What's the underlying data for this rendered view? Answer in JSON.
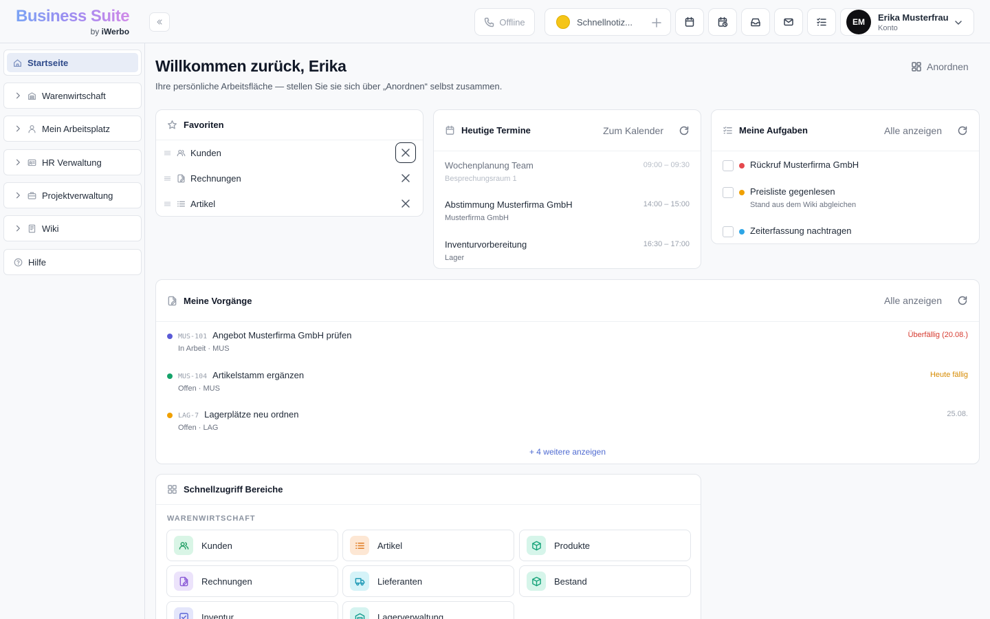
{
  "brand": {
    "title": "Business Suite",
    "by": "by",
    "company": "iWerbo"
  },
  "header": {
    "status": "Offline",
    "quick_note": "Schnellnotiz...",
    "user": {
      "initials": "EM",
      "name": "Erika Musterfrau",
      "role": "Konto"
    }
  },
  "sidebar": {
    "items": [
      {
        "label": "Startseite",
        "icon": "home-icon",
        "active": true
      },
      {
        "label": "Warenwirtschaft",
        "icon": "building-icon"
      },
      {
        "label": "Mein Arbeitsplatz",
        "icon": "user-icon"
      },
      {
        "label": "HR Verwaltung",
        "icon": "id-card-icon"
      },
      {
        "label": "Projektverwaltung",
        "icon": "briefcase-icon"
      },
      {
        "label": "Wiki",
        "icon": "book-icon"
      },
      {
        "label": "Hilfe",
        "icon": "help-icon"
      }
    ]
  },
  "main": {
    "title": "Willkommen zurück, Erika",
    "subtitle": "Ihre persönliche Arbeitsfläche — stellen Sie sie sich über „Anordnen“ selbst zusammen.",
    "arrange": "Anordnen"
  },
  "favorites": {
    "title": "Favoriten",
    "items": [
      {
        "label": "Kunden",
        "icon": "users-icon"
      },
      {
        "label": "Rechnungen",
        "icon": "invoice-icon"
      },
      {
        "label": "Artikel",
        "icon": "list-icon"
      }
    ]
  },
  "appointments": {
    "title": "Heutige Termine",
    "link": "Zum Kalender",
    "items": [
      {
        "title": "Wochenplanung Team",
        "place": "Besprechungsraum 1",
        "time": "09:00 – 09:30",
        "past": true
      },
      {
        "title": "Abstimmung Musterfirma GmbH",
        "place": "Musterfirma GmbH",
        "time": "14:00 – 15:00"
      },
      {
        "title": "Inventurvorbereitung",
        "place": "Lager",
        "time": "16:30 – 17:00"
      }
    ]
  },
  "tasks": {
    "title": "Meine Aufgaben",
    "link": "Alle anzeigen",
    "items": [
      {
        "title": "Rückruf Musterfirma GmbH",
        "sub": "",
        "color": "#e5484d"
      },
      {
        "title": "Preisliste gegenlesen",
        "sub": "Stand aus dem Wiki abgleichen",
        "color": "#f0a000"
      },
      {
        "title": "Zeiterfassung nachtragen",
        "sub": "",
        "color": "#2ea6e6"
      }
    ]
  },
  "processes": {
    "title": "Meine Vorgänge",
    "link": "Alle anzeigen",
    "more": "+ 4 weitere anzeigen",
    "items": [
      {
        "code": "MUS-101",
        "title": "Angebot Musterfirma GmbH prüfen",
        "meta": "In Arbeit · MUS",
        "due": "Überfällig (20.08.)",
        "dot": "#5b5bd6",
        "due_color": "#d63a2f"
      },
      {
        "code": "MUS-104",
        "title": "Artikelstamm ergänzen",
        "meta": "Offen · MUS",
        "due": "Heute fällig",
        "dot": "#16a36a",
        "due_color": "#d68a00"
      },
      {
        "code": "LAG-7",
        "title": "Lagerplätze neu ordnen",
        "meta": "Offen · LAG",
        "due": "25.08.",
        "dot": "#f0a000",
        "due_color": "#9aa1ad"
      }
    ]
  },
  "quick_access": {
    "title": "Schnellzugriff Bereiche",
    "section": "WARENWIRTSCHAFT",
    "tiles": [
      {
        "label": "Kunden",
        "icon": "users-icon",
        "bg": "#d9f5e6",
        "fg": "#1f9d63"
      },
      {
        "label": "Artikel",
        "icon": "list-icon",
        "bg": "#fde7d4",
        "fg": "#e07a1f"
      },
      {
        "label": "Produkte",
        "icon": "cube-icon",
        "bg": "#d6f5ea",
        "fg": "#17a37a"
      },
      {
        "label": "Rechnungen",
        "icon": "invoice-icon",
        "bg": "#ece3fb",
        "fg": "#8a5ad6"
      },
      {
        "label": "Lieferanten",
        "icon": "truck-icon",
        "bg": "#d5f3f8",
        "fg": "#1796b3"
      },
      {
        "label": "Bestand",
        "icon": "cube-icon",
        "bg": "#d6f5ea",
        "fg": "#17a37a"
      },
      {
        "label": "Inventur",
        "icon": "check-square-icon",
        "bg": "#e4e6fb",
        "fg": "#5a63d6"
      },
      {
        "label": "Lagerverwaltung",
        "icon": "warehouse-icon",
        "bg": "#d5f3f0",
        "fg": "#149c8f"
      }
    ]
  }
}
